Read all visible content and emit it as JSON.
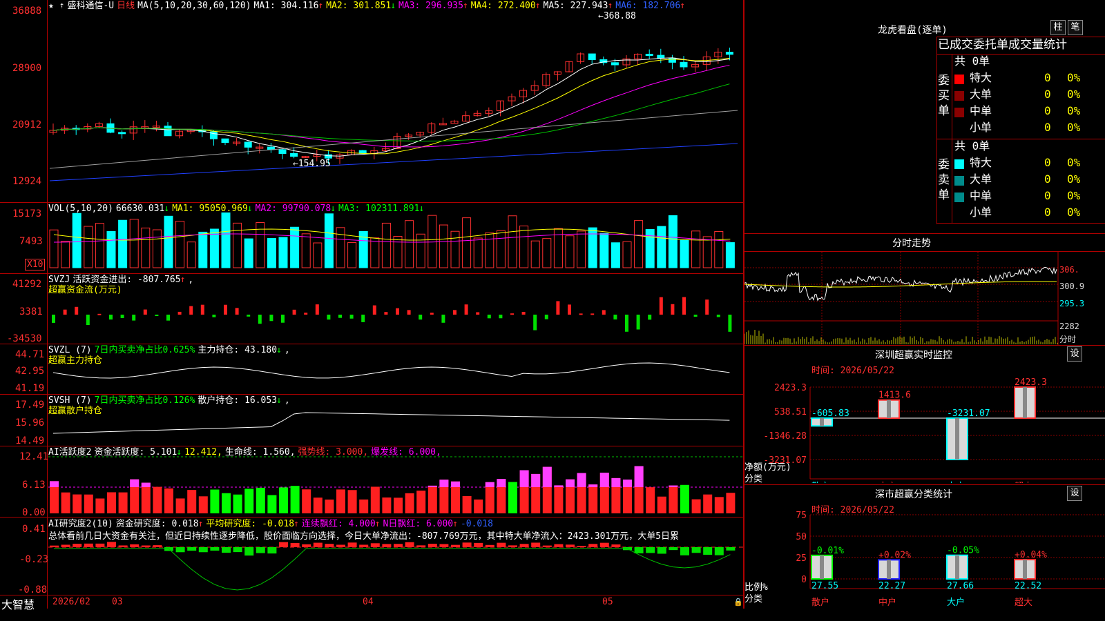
{
  "header": {
    "icons": "★ ⇡",
    "name": "盛科通信-U",
    "period": "日线",
    "ma_label": "MA(5,10,20,30,60,120)",
    "ma1": "MA1: 304.116",
    "ma2": "MA2: 301.851",
    "ma3": "MA3: 296.935",
    "ma4": "MA4: 272.400",
    "ma5": "MA5: 227.943",
    "ma6": "MA6: 182.706",
    "up": "↑",
    "down": "↓"
  },
  "price_axis": [
    "36888",
    "28900",
    "20912",
    "12924"
  ],
  "price_annot": {
    "high": "368.88",
    "low": "154.95"
  },
  "vol": {
    "label": "VOL(5,10,20)",
    "val": "66630.031",
    "ma1": "MA1: 95050.969",
    "ma2": "MA2: 99790.078",
    "ma3": "MA3: 102311.891",
    "axis": [
      "15173",
      "7493"
    ],
    "x10": "X10"
  },
  "svzj": {
    "label": "SVZJ",
    "text": "活跃资金进出: -807.765",
    "sub": "超赢资金流(万元)",
    "axis": [
      "41292",
      "3381",
      "-34530"
    ]
  },
  "svzl": {
    "label": "SVZL (7)",
    "text1": "7日内买卖净占比0.625%",
    "text2": "主力持仓: 43.180",
    "sub": "超赢主力持仓",
    "axis": [
      "44.71",
      "42.95",
      "41.19"
    ]
  },
  "svsh": {
    "label": "SVSH (7)",
    "text1": "7日内买卖净占比0.126%",
    "text2": "散户持仓: 16.053",
    "sub": "超赢散户持仓",
    "axis": [
      "17.49",
      "15.96",
      "14.49"
    ]
  },
  "ai1": {
    "label": "AI活跃度2",
    "t1": "资金活跃度: 5.101",
    "t2": "12.412,",
    "t3": "生命线: 1.560,",
    "t4": "强势线: 3.000,",
    "t5": "爆发线: 6.000,",
    "axis": [
      "12.41",
      "6.13",
      "0.00"
    ]
  },
  "ai2": {
    "label": "AI研究度2(10)",
    "t1": "资金研究度: 0.018",
    "t2": "平均研究度: -0.018",
    "t3": "连续飘红: 4.000",
    "t4": "N日飘红: 6.000",
    "t5": "-0.018",
    "summary": "总体看前几日大资金有关注，但近日持续性逐步降低，股价面临方向选择，今日大单净流出：-807.769万元，其中特大单净流入：2423.301万元，大单5日累",
    "axis": [
      "0.41",
      "-0.23",
      "-0.88"
    ]
  },
  "bottom": {
    "logo": "大智慧",
    "dates": [
      "2026/02",
      "03",
      "04",
      "05"
    ]
  },
  "longhu": {
    "title": "龙虎看盘(逐单)",
    "btn1": "柱",
    "btn2": "笔",
    "subtitle": "已成交委托单成交量统计",
    "buy_label": "委买单",
    "sell_label": "委卖单",
    "buy_total": "共 0单",
    "sell_total": "共 0单",
    "buy_rows": [
      {
        "name": "特大",
        "n": "0",
        "p": "0%"
      },
      {
        "name": "大单",
        "n": "0",
        "p": "0%"
      },
      {
        "name": "中单",
        "n": "0",
        "p": "0%"
      },
      {
        "name": "小单",
        "n": "0",
        "p": "0%"
      }
    ],
    "sell_rows": [
      {
        "name": "特大",
        "n": "0",
        "p": "0%"
      },
      {
        "name": "大单",
        "n": "0",
        "p": "0%"
      },
      {
        "name": "中单",
        "n": "0",
        "p": "0%"
      },
      {
        "name": "小单",
        "n": "0",
        "p": "0%"
      }
    ],
    "colors": {
      "buy": [
        "#ff0000",
        "#8b0000",
        "#8b0000",
        "#000000"
      ],
      "sell": [
        "#00ffff",
        "#008b8b",
        "#008b8b",
        "#000000"
      ]
    }
  },
  "fenshi": {
    "title": "分时走势",
    "axis": [
      "306.",
      "300.9",
      "295.3",
      "2282",
      "分时"
    ]
  },
  "sz_monitor": {
    "title": "深圳超赢实时监控",
    "btn": "设",
    "time": "时间: 2026/05/22",
    "axis": [
      "2423.3",
      "538.51",
      "-1346.28",
      "-3231.07"
    ],
    "ylabel1": "净额(万元)",
    "ylabel2": "分类",
    "bars": [
      {
        "cat": "散户",
        "val": -605.83,
        "label": "-605.83",
        "color": "#00ffff"
      },
      {
        "cat": "中户",
        "val": 1413.6,
        "label": "1413.6",
        "color": "#ff3030"
      },
      {
        "cat": "大户",
        "val": -3231.07,
        "label": "-3231.07",
        "color": "#00ffff"
      },
      {
        "cat": "超大",
        "val": 2423.3,
        "label": "2423.3",
        "color": "#ff3030"
      }
    ]
  },
  "sz_class": {
    "title": "深市超赢分类统计",
    "btn": "设",
    "time": "时间: 2026/05/22",
    "axis": [
      "75",
      "50",
      "25",
      "0"
    ],
    "ylabel1": "比例%",
    "ylabel2": "分类",
    "bars": [
      {
        "cat": "散户",
        "val": 27.55,
        "label": "27.55",
        "top": "-0.01%",
        "color": "#00ff00"
      },
      {
        "cat": "中户",
        "val": 22.27,
        "label": "22.27",
        "top": "+0.02%",
        "color": "#2020ff"
      },
      {
        "cat": "大户",
        "val": 27.66,
        "label": "27.66",
        "top": "-0.05%",
        "color": "#00ffff"
      },
      {
        "cat": "超大",
        "val": 22.52,
        "label": "22.52",
        "top": "+0.04%",
        "color": "#ff3030"
      }
    ]
  }
}
